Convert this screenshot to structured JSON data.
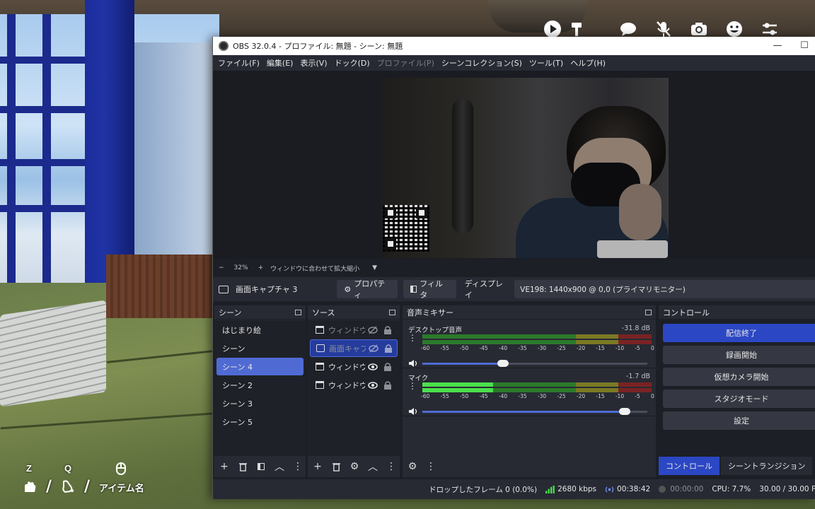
{
  "game": {
    "hud_keys": {
      "z": "Z",
      "q": "Q"
    },
    "item_label": "アイテム名",
    "top_icons": [
      "play-icon",
      "hammer-icon",
      "chat-icon",
      "mic-muted-icon",
      "camera-icon",
      "emote-icon",
      "sliders-icon"
    ]
  },
  "obs": {
    "title": "OBS 32.0.4 - プロファイル: 無題 - シーン: 無題",
    "menu": [
      {
        "label": "ファイル(F)",
        "disabled": false
      },
      {
        "label": "編集(E)",
        "disabled": false
      },
      {
        "label": "表示(V)",
        "disabled": false
      },
      {
        "label": "ドック(D)",
        "disabled": false
      },
      {
        "label": "プロファイル(P)",
        "disabled": true
      },
      {
        "label": "シーンコレクション(S)",
        "disabled": false
      },
      {
        "label": "ツール(T)",
        "disabled": false
      },
      {
        "label": "ヘルプ(H)",
        "disabled": false
      }
    ],
    "zoom": {
      "minus": "−",
      "value": "32%",
      "plus": "+",
      "fit_label": "ウィンドウに合わせて拡大縮小"
    },
    "source_toolbar": {
      "source_name": "画面キャプチャ 3",
      "properties_label": "プロパティ",
      "filters_label": "フィルタ",
      "display_label": "ディスプレイ",
      "display_value": "VE198: 1440x900 @ 0,0 (プライマリモニター)"
    },
    "scenes": {
      "title": "シーン",
      "items": [
        {
          "label": "はじまり絵",
          "selected": false
        },
        {
          "label": "シーン",
          "selected": false
        },
        {
          "label": "シーン 4",
          "selected": true
        },
        {
          "label": "シーン 2",
          "selected": false
        },
        {
          "label": "シーン 3",
          "selected": false
        },
        {
          "label": "シーン 5",
          "selected": false
        }
      ]
    },
    "sources": {
      "title": "ソース",
      "items": [
        {
          "label": "ウィンドウキ",
          "visible": false,
          "selected": false
        },
        {
          "label": "画面キャプ",
          "visible": false,
          "selected": true
        },
        {
          "label": "ウィンドウキ",
          "visible": true,
          "selected": false
        },
        {
          "label": "ウィンドウキ",
          "visible": true,
          "selected": false
        }
      ]
    },
    "mixer": {
      "title": "音声ミキサー",
      "tracks": [
        {
          "name": "デスクトップ音声",
          "db": "-31.8 dB",
          "level": 0.0,
          "volume": 0.36
        },
        {
          "name": "マイク",
          "db": "-1.7 dB",
          "level": 0.31,
          "volume": 0.9
        }
      ],
      "ticks": [
        "-60",
        "-55",
        "-50",
        "-45",
        "-40",
        "-35",
        "-30",
        "-25",
        "-20",
        "-15",
        "-10",
        "-5",
        "0"
      ]
    },
    "controls": {
      "title": "コントロール",
      "buttons": [
        "配信終了",
        "録画開始",
        "仮想カメラ開始",
        "スタジオモード",
        "設定"
      ],
      "tabs": [
        "コントロール",
        "シーントランジション"
      ]
    },
    "status": {
      "dropped": "ドロップしたフレーム 0 (0.0%)",
      "bitrate": "2680 kbps",
      "stream_time": "00:38:42",
      "rec_time": "00:00:00",
      "cpu": "CPU: 7.7%",
      "fps": "30.00 / 30.00 F"
    },
    "colors": {
      "accent": "#4f6bd3",
      "primary_button": "#2b47c4",
      "live_green": "#4ce04c"
    }
  }
}
